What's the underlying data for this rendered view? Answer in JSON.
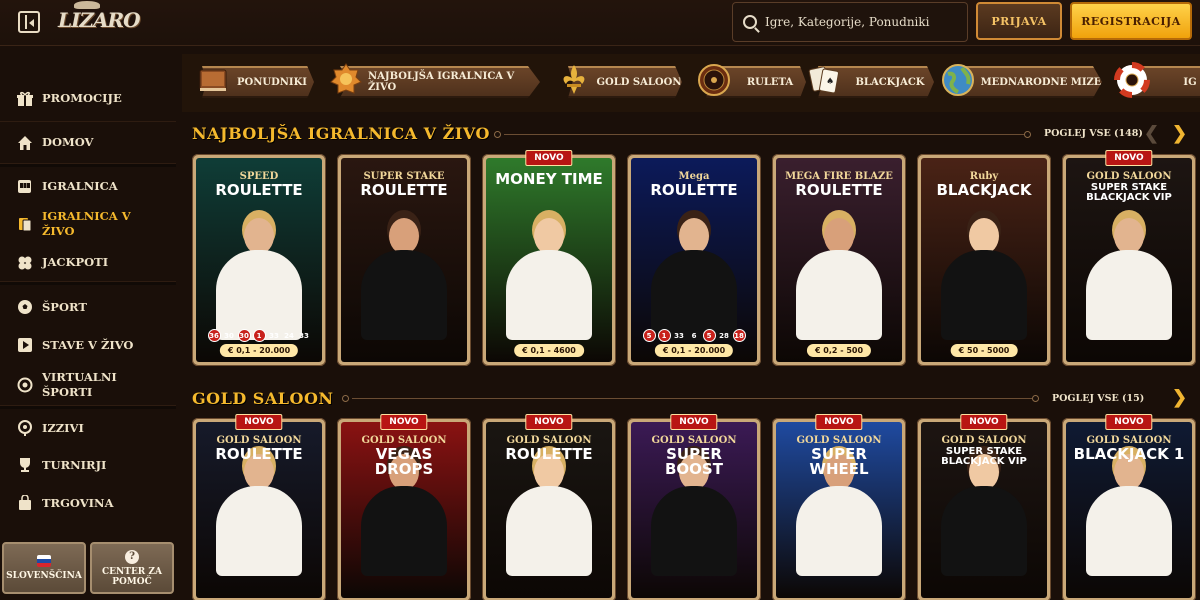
{
  "header": {
    "logo_text": "LIZARO",
    "search_placeholder": "Igre, Kategorije, Ponudniki",
    "login_label": "PRIJAVA",
    "register_label": "REGISTRACIJA"
  },
  "sidebar": {
    "items": [
      {
        "label": "PROMOCIJE",
        "icon": "gift-icon"
      },
      {
        "label": "DOMOV",
        "icon": "home-icon"
      },
      {
        "label": "IGRALNICA",
        "icon": "slot-machine-icon"
      },
      {
        "label": "IGRALNICA V ŽIVO",
        "icon": "live-cards-icon",
        "active": true
      },
      {
        "label": "JACKPOTI",
        "icon": "clover-icon"
      },
      {
        "label": "ŠPORT",
        "icon": "soccer-ball-icon"
      },
      {
        "label": "STAVE V ŽIVO",
        "icon": "play-icon"
      },
      {
        "label": "VIRTUALNI ŠPORTI",
        "icon": "virtual-sport-icon"
      },
      {
        "label": "IZZIVI",
        "icon": "target-icon"
      },
      {
        "label": "TURNIRJI",
        "icon": "trophy-icon"
      },
      {
        "label": "TRGOVINA",
        "icon": "shop-bag-icon"
      }
    ],
    "language_label": "SLOVENŠČINA",
    "help_label": "CENTER ZA POMOČ"
  },
  "categories": [
    {
      "label": "PONUDNIKI",
      "icon": "book-icon"
    },
    {
      "label": "NAJBOLJŠA IGRALNICA V ŽIVO",
      "icon": "badge-icon"
    },
    {
      "label": "GOLD SALOON",
      "icon": "fleur-de-lis-icon"
    },
    {
      "label": "RULETA",
      "icon": "roulette-wheel-icon"
    },
    {
      "label": "BLACKJACK",
      "icon": "playing-cards-icon"
    },
    {
      "label": "MEDNARODNE MIZE",
      "icon": "globe-icon"
    },
    {
      "label": "IG",
      "icon": "lifebuoy-icon"
    }
  ],
  "sections": [
    {
      "title": "NAJBOLJŠA IGRALNICA V ŽIVO",
      "view_all": "POGLEJ VSE (148)",
      "cards": [
        {
          "title": "ROULETTE",
          "subtitle": "SPEED",
          "badge": "",
          "limit": "€ 0,1 - 20.000",
          "numbers": [
            "36",
            "30",
            "30",
            "1",
            "33",
            "24",
            "33"
          ],
          "red": [
            0,
            2,
            3
          ],
          "bg": "#0f3d37"
        },
        {
          "title": "ROULETTE",
          "subtitle": "SUPER STAKE",
          "badge": "",
          "limit": "",
          "numbers": [],
          "red": [],
          "bg": "#2a1710"
        },
        {
          "title": "MONEY TIME",
          "subtitle": "",
          "badge": "NOVO",
          "limit": "€ 0,1 - 4600",
          "numbers": [],
          "red": [],
          "bg": "#2f7a2b"
        },
        {
          "title": "ROULETTE",
          "subtitle": "Mega",
          "badge": "",
          "limit": "€ 0,1 - 20.000",
          "numbers": [
            "5",
            "1",
            "33",
            "6",
            "5",
            "28",
            "18"
          ],
          "red": [
            0,
            1,
            4,
            6
          ],
          "bg": "#0c1a5a"
        },
        {
          "title": "ROULETTE",
          "subtitle": "MEGA FIRE BLAZE",
          "badge": "",
          "limit": "€ 0,2 - 500",
          "numbers": [],
          "red": [],
          "bg": "#3a1f2e"
        },
        {
          "title": "BLACKJACK",
          "subtitle": "Ruby",
          "badge": "",
          "limit": "€ 50 - 5000",
          "numbers": [],
          "red": [],
          "bg": "#4a2316"
        },
        {
          "title": "SUPER STAKE BLACKJACK VIP",
          "subtitle": "GOLD SALOON",
          "badge": "NOVO",
          "limit": "",
          "numbers": [],
          "red": [],
          "bg": "#1d1512"
        }
      ]
    },
    {
      "title": "GOLD SALOON",
      "view_all": "POGLEJ VSE (15)",
      "cards": [
        {
          "title": "ROULETTE",
          "subtitle": "GOLD SALOON",
          "badge": "NOVO",
          "limit": "",
          "numbers": [],
          "red": [],
          "bg": "#161a2a"
        },
        {
          "title": "VEGAS DROPS",
          "subtitle": "GOLD SALOON",
          "badge": "NOVO",
          "limit": "",
          "numbers": [],
          "red": [],
          "bg": "#8a1212"
        },
        {
          "title": "ROULETTE",
          "subtitle": "GOLD SALOON",
          "badge": "NOVO",
          "limit": "",
          "numbers": [],
          "red": [],
          "bg": "#1a1612"
        },
        {
          "title": "SUPER BOOST",
          "subtitle": "GOLD SALOON",
          "badge": "NOVO",
          "limit": "",
          "numbers": [],
          "red": [],
          "bg": "#3b1a55"
        },
        {
          "title": "SUPER WHEEL",
          "subtitle": "GOLD SALOON",
          "badge": "NOVO",
          "limit": "",
          "numbers": [],
          "red": [],
          "bg": "#1f4aa0"
        },
        {
          "title": "SUPER STAKE BLACKJACK VIP",
          "subtitle": "GOLD SALOON",
          "badge": "NOVO",
          "limit": "",
          "numbers": [],
          "red": [],
          "bg": "#1d1512"
        },
        {
          "title": "BLACKJACK 1",
          "subtitle": "GOLD SALOON",
          "badge": "NOVO",
          "limit": "",
          "numbers": [],
          "red": [],
          "bg": "#0f1a33"
        }
      ]
    }
  ],
  "colors": {
    "accent_gold": "#f5b92d",
    "background": "#1a0f09",
    "register_button": "#f0a20c"
  }
}
